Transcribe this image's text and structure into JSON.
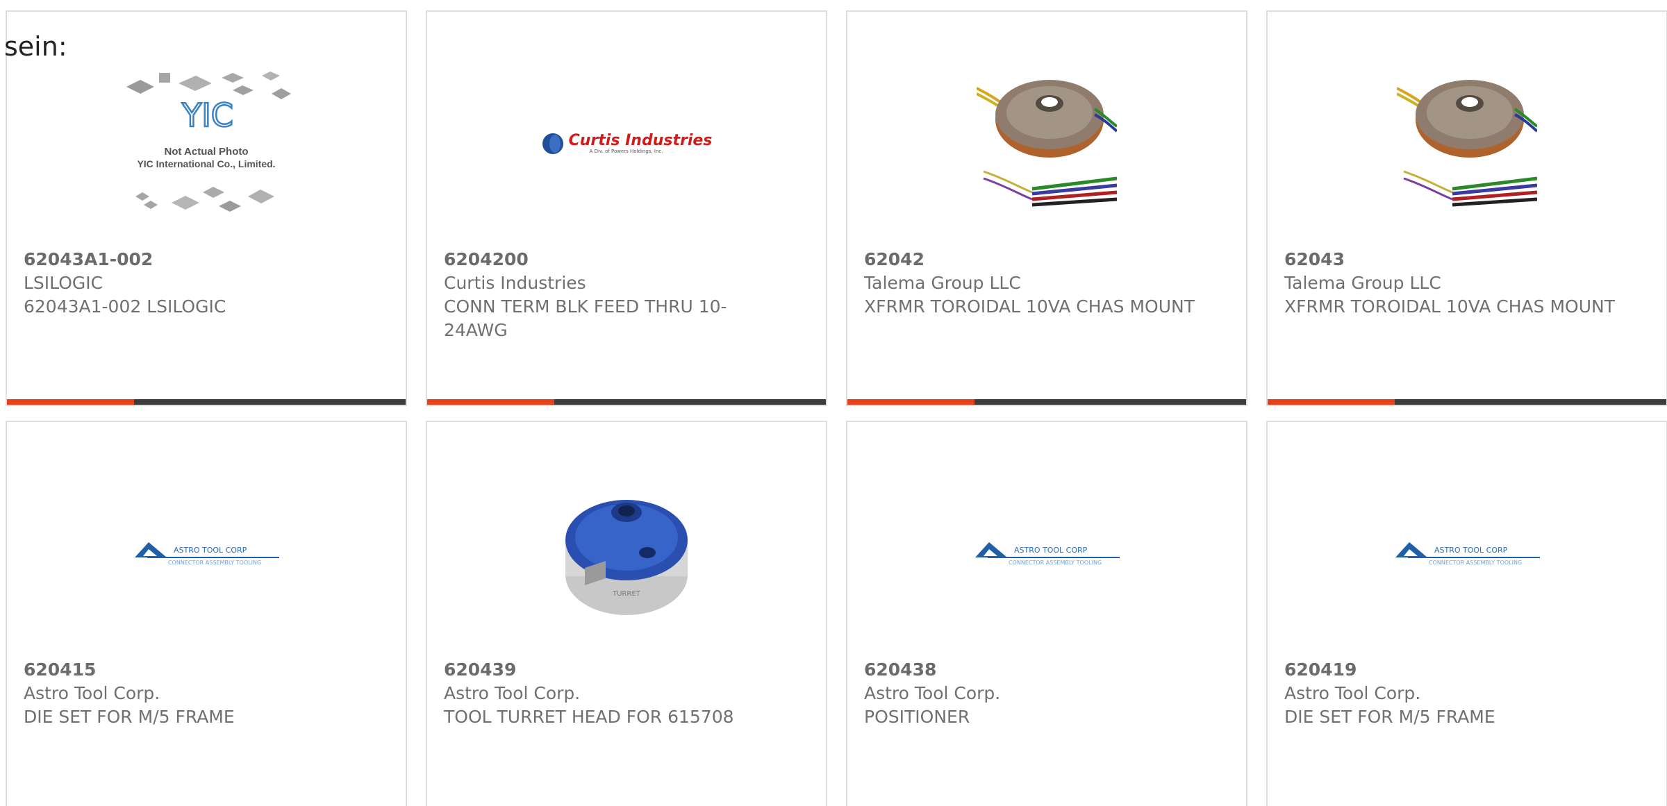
{
  "header_fragment": "sein:",
  "products": [
    {
      "part": "62043A1-002",
      "manufacturer": "LSILOGIC",
      "description": "62043A1-002 LSILOGIC",
      "image": "yic-not-actual-photo",
      "image_text": [
        "YIC",
        "Not Actual Photo",
        "YIC International Co., Limited."
      ]
    },
    {
      "part": "6204200",
      "manufacturer": "Curtis Industries",
      "description": "CONN TERM BLK FEED THRU 10-24AWG",
      "image": "curtis-industries-logo",
      "image_text": [
        "Curtis Industries",
        "A Div. of Powers Holdings, Inc."
      ]
    },
    {
      "part": "62042",
      "manufacturer": "Talema Group LLC",
      "description": "XFRMR TOROIDAL 10VA CHAS MOUNT",
      "image": "toroidal-transformer-photo"
    },
    {
      "part": "62043",
      "manufacturer": "Talema Group LLC",
      "description": "XFRMR TOROIDAL 10VA CHAS MOUNT",
      "image": "toroidal-transformer-photo"
    },
    {
      "part": "620415",
      "manufacturer": "Astro Tool Corp.",
      "description": "DIE SET FOR M/5 FRAME",
      "image": "astro-tool-logo",
      "image_text": [
        "ASTRO TOOL CORP",
        "CONNECTOR ASSEMBLY TOOLING"
      ]
    },
    {
      "part": "620439",
      "manufacturer": "Astro Tool Corp.",
      "description": "TOOL TURRET HEAD FOR 615708",
      "image": "turret-head-photo"
    },
    {
      "part": "620438",
      "manufacturer": "Astro Tool Corp.",
      "description": "POSITIONER",
      "image": "astro-tool-logo",
      "image_text": [
        "ASTRO TOOL CORP",
        "CONNECTOR ASSEMBLY TOOLING"
      ]
    },
    {
      "part": "620419",
      "manufacturer": "Astro Tool Corp.",
      "description": "DIE SET FOR M/5 FRAME",
      "image": "astro-tool-logo",
      "image_text": [
        "ASTRO TOOL CORP",
        "CONNECTOR ASSEMBLY TOOLING"
      ]
    }
  ],
  "colors": {
    "accent": "#e8411a",
    "bar": "#3d3d3d",
    "border": "#dedede",
    "text": "#707070"
  }
}
